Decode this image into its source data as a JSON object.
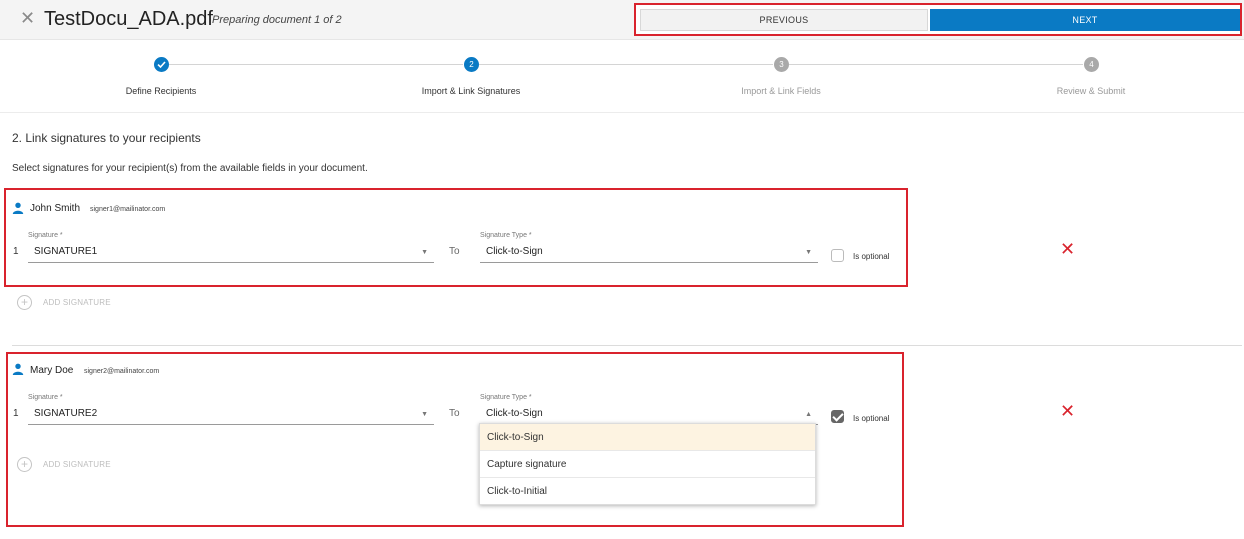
{
  "header": {
    "title": "TestDocu_ADA.pdf",
    "subtitle": "Preparing document 1 of 2",
    "previous_label": "PREVIOUS",
    "next_label": "NEXT"
  },
  "steps": [
    {
      "number": "",
      "label": "Define Recipients",
      "state": "done"
    },
    {
      "number": "2",
      "label": "Import & Link Signatures",
      "state": "active"
    },
    {
      "number": "3",
      "label": "Import & Link Fields",
      "state": "todo"
    },
    {
      "number": "4",
      "label": "Review & Submit",
      "state": "todo"
    }
  ],
  "section": {
    "title": "2. Link signatures to your recipients",
    "instructions": "Select signatures for your recipient(s) from the available fields in your document."
  },
  "recipients": [
    {
      "name": "John Smith",
      "email": "signer1@mailinator.com",
      "row_number": "1",
      "signature_label": "Signature *",
      "signature_value": "SIGNATURE1",
      "to_label": "To",
      "type_label": "Signature Type *",
      "type_value": "Click-to-Sign",
      "optional_label": "Is optional",
      "optional_checked": false,
      "add_label": "ADD SIGNATURE"
    },
    {
      "name": "Mary Doe",
      "email": "signer2@mailinator.com",
      "row_number": "1",
      "signature_label": "Signature *",
      "signature_value": "SIGNATURE2",
      "to_label": "To",
      "type_label": "Signature Type *",
      "type_value": "Click-to-Sign",
      "optional_label": "Is optional",
      "optional_checked": true,
      "add_label": "ADD SIGNATURE"
    }
  ],
  "dropdown": {
    "options": [
      "Click-to-Sign",
      "Capture signature",
      "Click-to-Initial"
    ],
    "selected": "Click-to-Sign"
  },
  "icons": {
    "close": "close-icon",
    "check": "check-icon",
    "person": "person-icon",
    "delete": "delete-icon",
    "add": "plus-circle-icon",
    "caret": "chevron-down-icon"
  },
  "colors": {
    "primary": "#0a7ac4",
    "highlight_border": "#d9232d",
    "delete": "#d9232d",
    "selected_option_bg": "#fdf3e1"
  }
}
